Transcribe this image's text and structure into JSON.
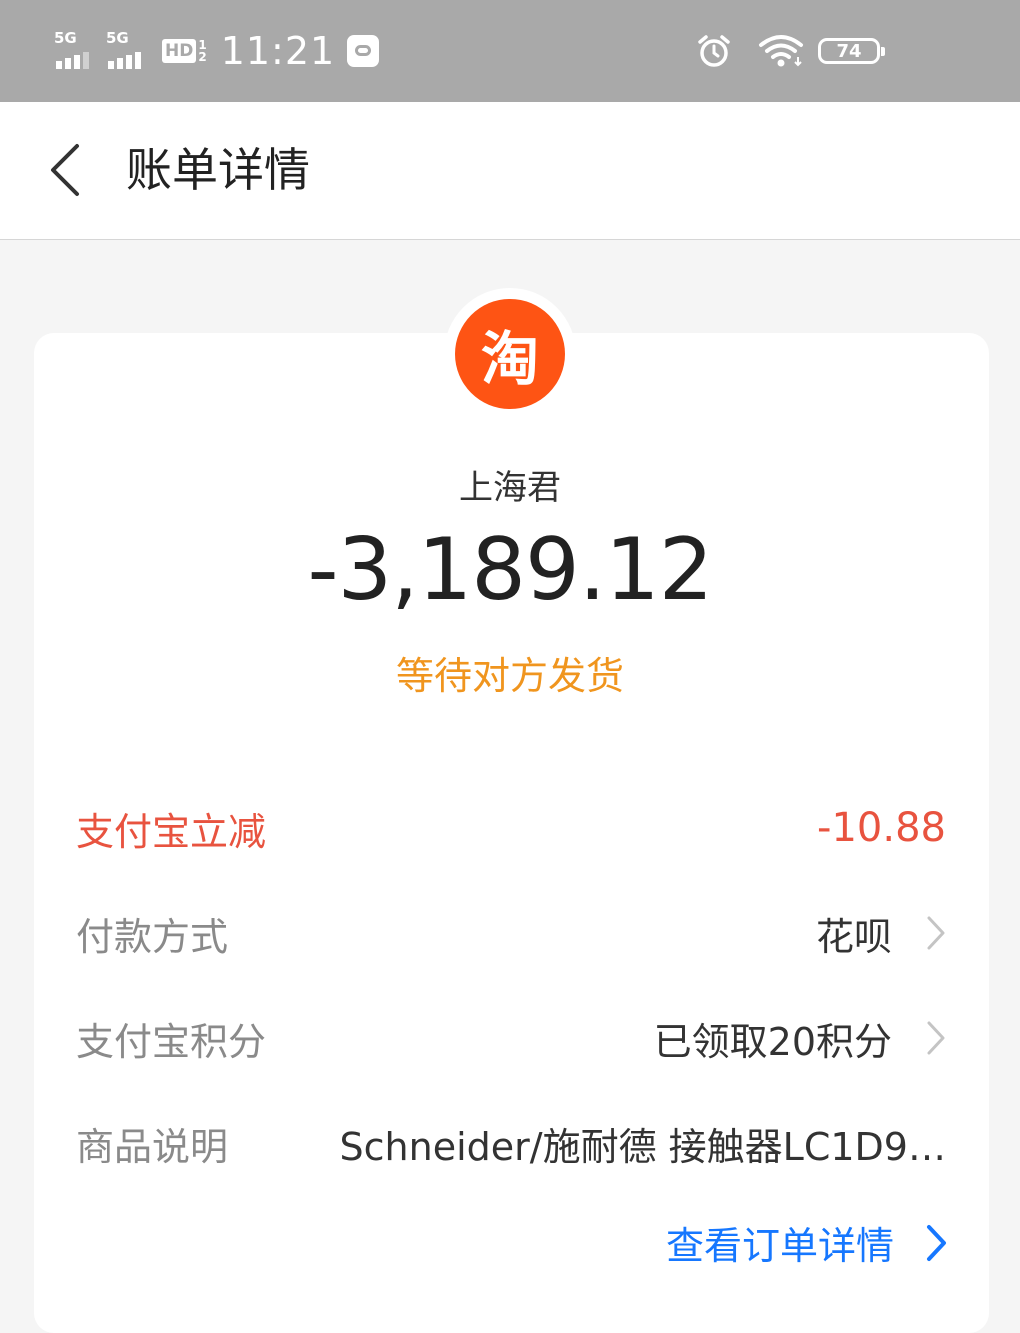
{
  "status_bar": {
    "sim1_network": "5G",
    "sim2_network": "5G",
    "hd_label": "HD",
    "hd_slot_top": "1",
    "hd_slot_bottom": "2",
    "time": "11:21",
    "battery_level": "74",
    "icons": [
      "signal-icon",
      "signal-icon",
      "hd-icon",
      "app-notification-icon",
      "alarm-icon",
      "wifi-icon",
      "battery-icon"
    ]
  },
  "nav": {
    "title": "账单详情",
    "back_icon": "chevron-left-icon"
  },
  "bill": {
    "merchant_logo_text": "淘",
    "merchant_name": "上海君",
    "amount": "-3,189.12",
    "status": "等待对方发货"
  },
  "details": {
    "discount": {
      "label": "支付宝立减",
      "value": "-10.88"
    },
    "payment_method": {
      "label": "付款方式",
      "value": "花呗"
    },
    "points": {
      "label": "支付宝积分",
      "value": "已领取20积分"
    },
    "description": {
      "label": "商品说明",
      "value": "Schneider/施耐德 接触器LC1D9…"
    }
  },
  "order_link": {
    "label": "查看订单详情"
  },
  "colors": {
    "status_bar_bg": "#a9a9a9",
    "taobao_orange": "#fe5414",
    "discount_red": "#e8533f",
    "status_orange": "#f0951e",
    "link_blue": "#1677ff",
    "label_gray": "#8a8a8a"
  }
}
